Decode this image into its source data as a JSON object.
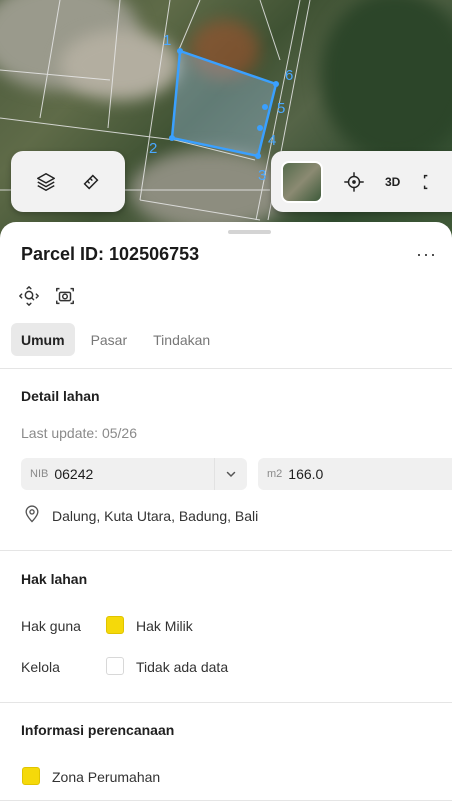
{
  "map": {
    "markers": [
      "1",
      "2",
      "3",
      "4",
      "5",
      "6"
    ],
    "polygon_color": "#3aa0ff"
  },
  "map_controls": {
    "layers_icon": "layers-icon",
    "measure_icon": "ruler-icon",
    "locate_icon": "crosshair-icon",
    "label_3d": "3D"
  },
  "parcel": {
    "title": "Parcel ID: 102506753",
    "more_label": "···"
  },
  "tabs": [
    {
      "label": "Umum",
      "active": true
    },
    {
      "label": "Pasar",
      "active": false
    },
    {
      "label": "Tindakan",
      "active": false
    }
  ],
  "detail": {
    "title": "Detail lahan",
    "last_update": "Last update: 05/26",
    "nib_label": "NIB",
    "nib_value": "06242",
    "area_label": "m2",
    "area_value": "166.0",
    "address": "Dalung, Kuta Utara, Badung, Bali"
  },
  "hak": {
    "title": "Hak lahan",
    "rows": [
      {
        "label": "Hak guna",
        "value": "Hak Milik",
        "color": "#f5d90a"
      },
      {
        "label": "Kelola",
        "value": "Tidak ada data",
        "color": "#ffffff"
      }
    ]
  },
  "planning": {
    "title": "Informasi perencanaan",
    "zone": "Zona Perumahan",
    "zone_color": "#f5d90a"
  }
}
